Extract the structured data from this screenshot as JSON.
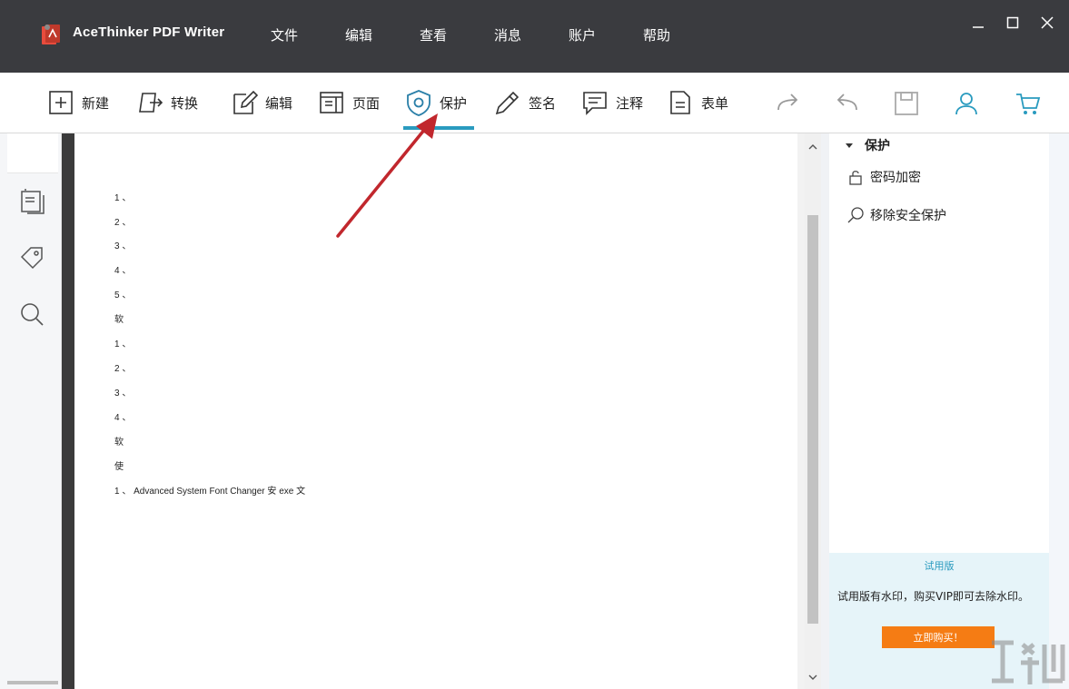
{
  "app": {
    "title": "AceThinker PDF Writer"
  },
  "menu": [
    "文件",
    "编辑",
    "查看",
    "消息",
    "账户",
    "帮助"
  ],
  "toolbar": {
    "new": "新建",
    "convert": "转换",
    "edit": "编辑",
    "page": "页面",
    "protect": "保护",
    "sign": "签名",
    "annotate": "注释",
    "form": "表单"
  },
  "document": {
    "lines": [
      "1 、",
      "2 、",
      "3 、",
      "4 、",
      "5 、",
      "软",
      "1 、",
      "2 、",
      "3 、",
      "4 、",
      "软",
      "使",
      "1 、 Advanced System Font Changer 安 exe 文"
    ]
  },
  "panel": {
    "section": "保护",
    "items": [
      "密码加密",
      "移除安全保护"
    ]
  },
  "trial": {
    "title": "试用版",
    "text": "试用版有水印，购买VIP即可去除水印。",
    "buy_label": "立即购买！"
  },
  "colors": {
    "accent": "#2a9bbf",
    "titlebar": "#3a3b3f",
    "buy": "#f57c14",
    "annotation_arrow": "#c1272d"
  }
}
